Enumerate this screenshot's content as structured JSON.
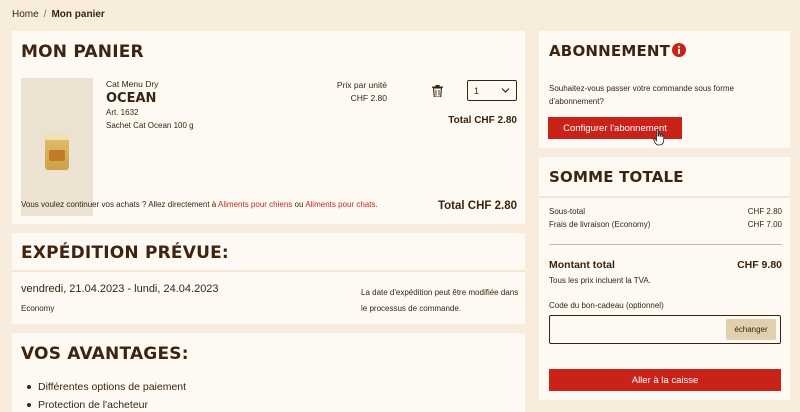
{
  "breadcrumb": {
    "home": "Home",
    "separator": "/",
    "current": "Mon panier"
  },
  "cart": {
    "title": "MON PANIER",
    "item": {
      "category": "Cat Menu Dry",
      "name": "OCEAN",
      "article": "Art. 1632",
      "description": "Sachet Cat Ocean 100 g",
      "unit_price_label": "Prix par unité",
      "unit_price": "CHF 2.80",
      "quantity": "1",
      "total": "Total CHF 2.80"
    },
    "continue_text": "Vous voulez continuer vos achats ? Allez directement à ",
    "link_dogs": "Aliments pour chiens",
    "or_text": " ou ",
    "link_cats": "Aliments pour chats",
    "end_text": ".",
    "grand_total": "Total CHF 2.80"
  },
  "shipping": {
    "title": "EXPÉDITION PRÉVUE:",
    "dates": "vendredi, 21.04.2023 - lundi, 24.04.2023",
    "method": "Economy",
    "note": "La date d'expédition peut être modifiée dans le processus de commande."
  },
  "benefits": {
    "title": "VOS AVANTAGES:",
    "items": [
      "Différentes options de paiement",
      "Protection de l'acheteur"
    ]
  },
  "subscription": {
    "title": "ABONNEMENT",
    "text": "Souhaitez-vous passer votre commande sous forme d'abonnement?",
    "button": "Configurer l'abonnement"
  },
  "summary": {
    "title": "SOMME TOTALE",
    "subtotal_label": "Sous-total",
    "subtotal_value": "CHF 2.80",
    "shipping_label": "Frais de livraison (Economy)",
    "shipping_value": "CHF 7.00",
    "total_label": "Montant total",
    "total_value": "CHF 9.80",
    "vat_note": "Tous les prix incluent la TVA.",
    "code_label": "Code du bon-cadeau (optionnel)",
    "code_value": "",
    "exchange_button": "échanger",
    "checkout_button": "Aller à la caisse"
  },
  "colors": {
    "background": "#f8eddc",
    "card": "#fefaf3",
    "accent": "#c92219",
    "text": "#3a2410"
  },
  "icons": [
    "trash-icon",
    "chevron-down-icon",
    "info-icon",
    "cursor-icon"
  ]
}
